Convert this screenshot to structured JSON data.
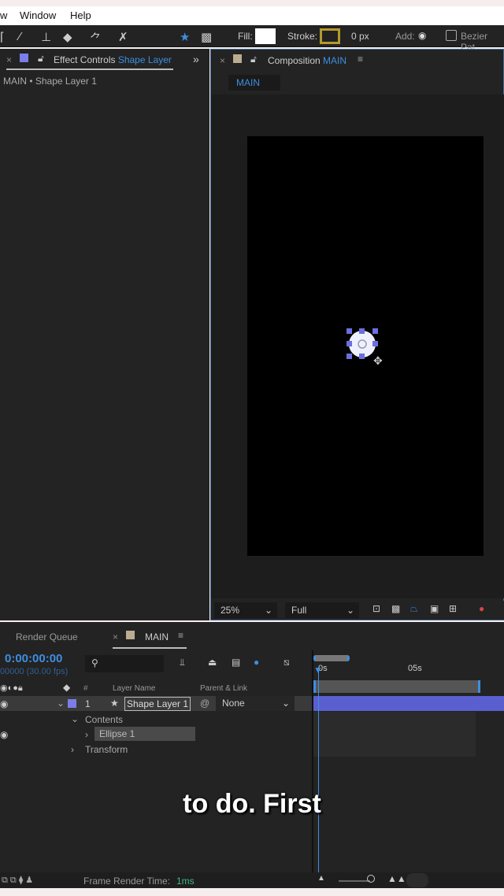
{
  "menubar": {
    "items": [
      "w",
      "Window",
      "Help"
    ]
  },
  "toolbar": {
    "fill_label": "Fill:",
    "stroke_label": "Stroke:",
    "stroke_width": "0 px",
    "add_label": "Add:",
    "bezier_label": "Bezier Pat"
  },
  "effect_controls": {
    "tab_label": "Effect Controls",
    "layer_link": "Shape Layer",
    "breadcrumb": "MAIN • Shape Layer 1"
  },
  "composition": {
    "tab_label": "Composition",
    "comp_name": "MAIN",
    "subtab": "MAIN",
    "zoom": "25%",
    "resolution": "Full"
  },
  "timeline": {
    "render_queue": "Render Queue",
    "tab": "MAIN",
    "timecode": "0:00:00:00",
    "frame_info": "00000 (30.00 fps)",
    "columns": {
      "num": "#",
      "layer_name": "Layer Name",
      "parent": "Parent & Link"
    },
    "ruler": [
      "0s",
      "05s"
    ],
    "layer": {
      "index": "1",
      "name": "Shape Layer 1",
      "parent": "None"
    },
    "children": [
      "Contents",
      "Ellipse 1",
      "Transform"
    ]
  },
  "status": {
    "label": "Frame Render Time:",
    "value": "1ms"
  },
  "caption": "to do. First",
  "colors": {
    "accent": "#3d8ee0",
    "layer_bar": "#5a5fd0",
    "label": "#7b7ee8"
  }
}
